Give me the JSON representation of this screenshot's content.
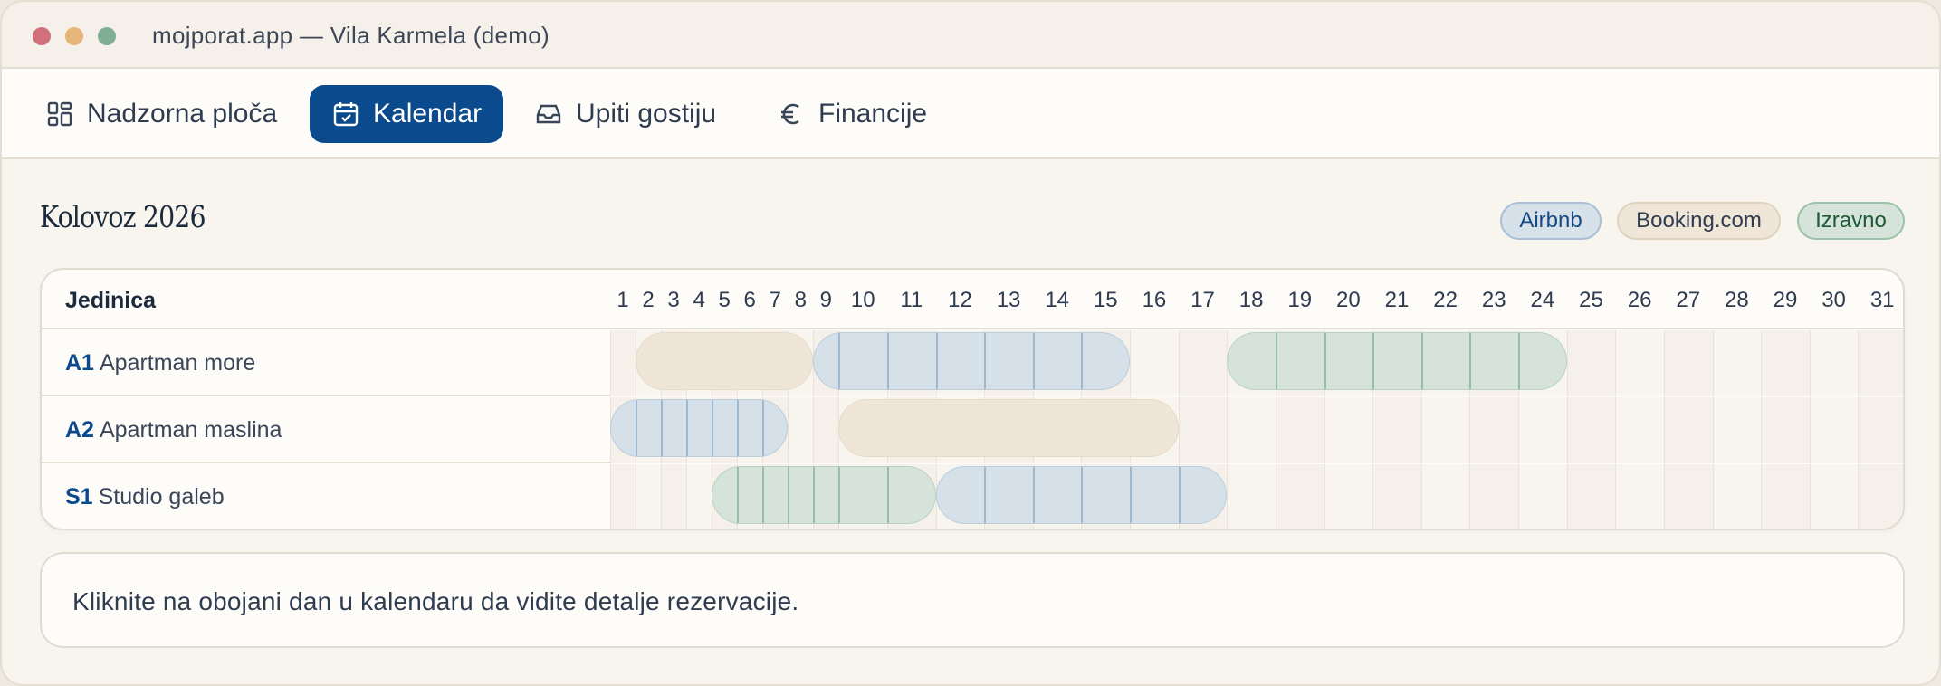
{
  "window": {
    "title": "mojporat.app — Vila Karmela (demo)"
  },
  "nav": {
    "tabs": [
      {
        "label": "Nadzorna ploča",
        "icon": "dashboard-icon",
        "active": false
      },
      {
        "label": "Kalendar",
        "icon": "calendar-check-icon",
        "active": true
      },
      {
        "label": "Upiti gostiju",
        "icon": "inbox-icon",
        "active": false
      },
      {
        "label": "Financije",
        "icon": "euro-icon",
        "active": false
      }
    ]
  },
  "calendar": {
    "month": "Kolovoz 2026",
    "legend": [
      {
        "label": "Airbnb",
        "color": "#d6e1ea"
      },
      {
        "label": "Booking.com",
        "color": "#efe6d7"
      },
      {
        "label": "Izravno",
        "color": "#d5e3da"
      }
    ],
    "unit_column_header": "Jedinica",
    "days": [
      "1",
      "2",
      "3",
      "4",
      "5",
      "6",
      "7",
      "8",
      "9",
      "10",
      "11",
      "12",
      "13",
      "14",
      "15",
      "16",
      "17",
      "18",
      "19",
      "20",
      "21",
      "22",
      "23",
      "24",
      "25",
      "26",
      "27",
      "28",
      "29",
      "30",
      "31"
    ],
    "units": [
      {
        "code": "A1",
        "name": "Apartman more"
      },
      {
        "code": "A2",
        "name": "Apartman maslina"
      },
      {
        "code": "S1",
        "name": "Studio galeb"
      }
    ],
    "bookings": [
      {
        "unit": 0,
        "channel": "booking",
        "from_day": 2,
        "to_day": 8
      },
      {
        "unit": 0,
        "channel": "airbnb",
        "from_day": 9,
        "to_day": 15
      },
      {
        "unit": 0,
        "channel": "direct",
        "from_day": 18,
        "to_day": 24
      },
      {
        "unit": 1,
        "channel": "airbnb",
        "from_day": 1,
        "to_day": 7
      },
      {
        "unit": 1,
        "channel": "booking",
        "from_day": 10,
        "to_day": 16
      },
      {
        "unit": 2,
        "channel": "direct",
        "from_day": 5,
        "to_day": 11
      },
      {
        "unit": 2,
        "channel": "airbnb",
        "from_day": 12,
        "to_day": 17
      }
    ]
  },
  "info": {
    "message": "Kliknite na obojani dan u kalendaru da vidite detalje rezervacije."
  }
}
